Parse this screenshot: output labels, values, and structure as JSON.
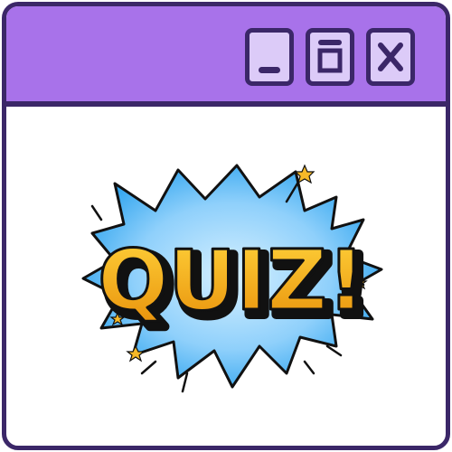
{
  "window": {
    "colors": {
      "titlebar": "#a872ea",
      "border": "#3b2768",
      "button_fill": "#dccbf8",
      "body": "#ffffff"
    },
    "buttons": [
      {
        "name": "minimize",
        "icon": "minimize-icon"
      },
      {
        "name": "maximize",
        "icon": "maximize-icon"
      },
      {
        "name": "close",
        "icon": "close-icon"
      }
    ]
  },
  "content": {
    "headline": "QUIZ!",
    "colors": {
      "burst_outer": "#1fa0ef",
      "burst_inner": "#bfe6ff",
      "text_top": "#ffd23a",
      "text_bottom": "#e8900a"
    }
  }
}
